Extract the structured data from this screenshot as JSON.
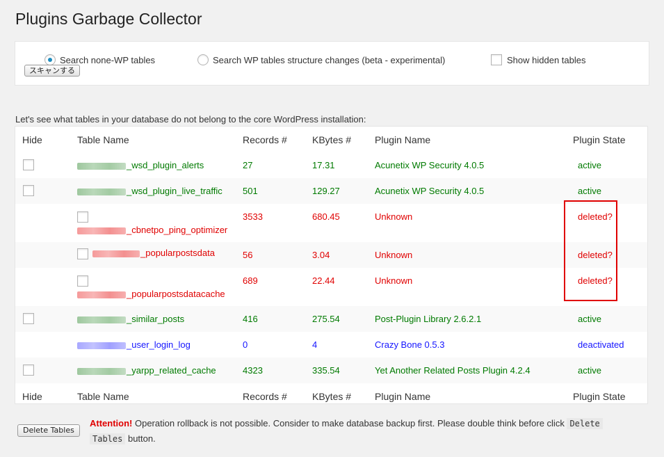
{
  "page_title": "Plugins Garbage Collector",
  "options": {
    "radio_none_wp": "Search none-WP tables",
    "radio_wp_structure": "Search WP tables structure changes (beta - experimental)",
    "show_hidden": "Show hidden tables",
    "scan_button": "スキャンする"
  },
  "intro_text": "Let's see what tables in your database do not belong to the core WordPress installation:",
  "columns": {
    "hide": "Hide",
    "table_name": "Table Name",
    "records": "Records #",
    "kbytes": "KBytes #",
    "plugin_name": "Plugin Name",
    "plugin_state": "Plugin State"
  },
  "rows": [
    {
      "table": "_wsd_plugin_alerts",
      "records": "27",
      "kbytes": "17.31",
      "plugin": "Acunetix WP Security 4.0.5",
      "state": "active"
    },
    {
      "table": "_wsd_plugin_live_traffic",
      "records": "501",
      "kbytes": "129.27",
      "plugin": "Acunetix WP Security 4.0.5",
      "state": "active"
    },
    {
      "table": "_cbnetpo_ping_optimizer",
      "records": "3533",
      "kbytes": "680.45",
      "plugin": "Unknown",
      "state": "deleted?"
    },
    {
      "table": "_popularpostsdata",
      "records": "56",
      "kbytes": "3.04",
      "plugin": "Unknown",
      "state": "deleted?"
    },
    {
      "table": "_popularpostsdatacache",
      "records": "689",
      "kbytes": "22.44",
      "plugin": "Unknown",
      "state": "deleted?"
    },
    {
      "table": "_similar_posts",
      "records": "416",
      "kbytes": "275.54",
      "plugin": "Post-Plugin Library 2.6.2.1",
      "state": "active"
    },
    {
      "table": "_user_login_log",
      "records": "0",
      "kbytes": "4",
      "plugin": "Crazy Bone 0.5.3",
      "state": "deactivated"
    },
    {
      "table": "_yarpp_related_cache",
      "records": "4323",
      "kbytes": "335.54",
      "plugin": "Yet Another Related Posts Plugin 4.2.4",
      "state": "active"
    }
  ],
  "footer": {
    "delete_button": "Delete Tables",
    "attention_label": "Attention!",
    "attention_text": " Operation rollback is not possible. Consider to make database backup first. Please double think before click ",
    "attention_code_1": "Delete",
    "attention_code_2": "Tables",
    "attention_after": " button."
  },
  "colors": {
    "active": "#007a00",
    "deleted": "#e00000",
    "deactivated": "#1515ff",
    "highlight": "#e00000"
  }
}
